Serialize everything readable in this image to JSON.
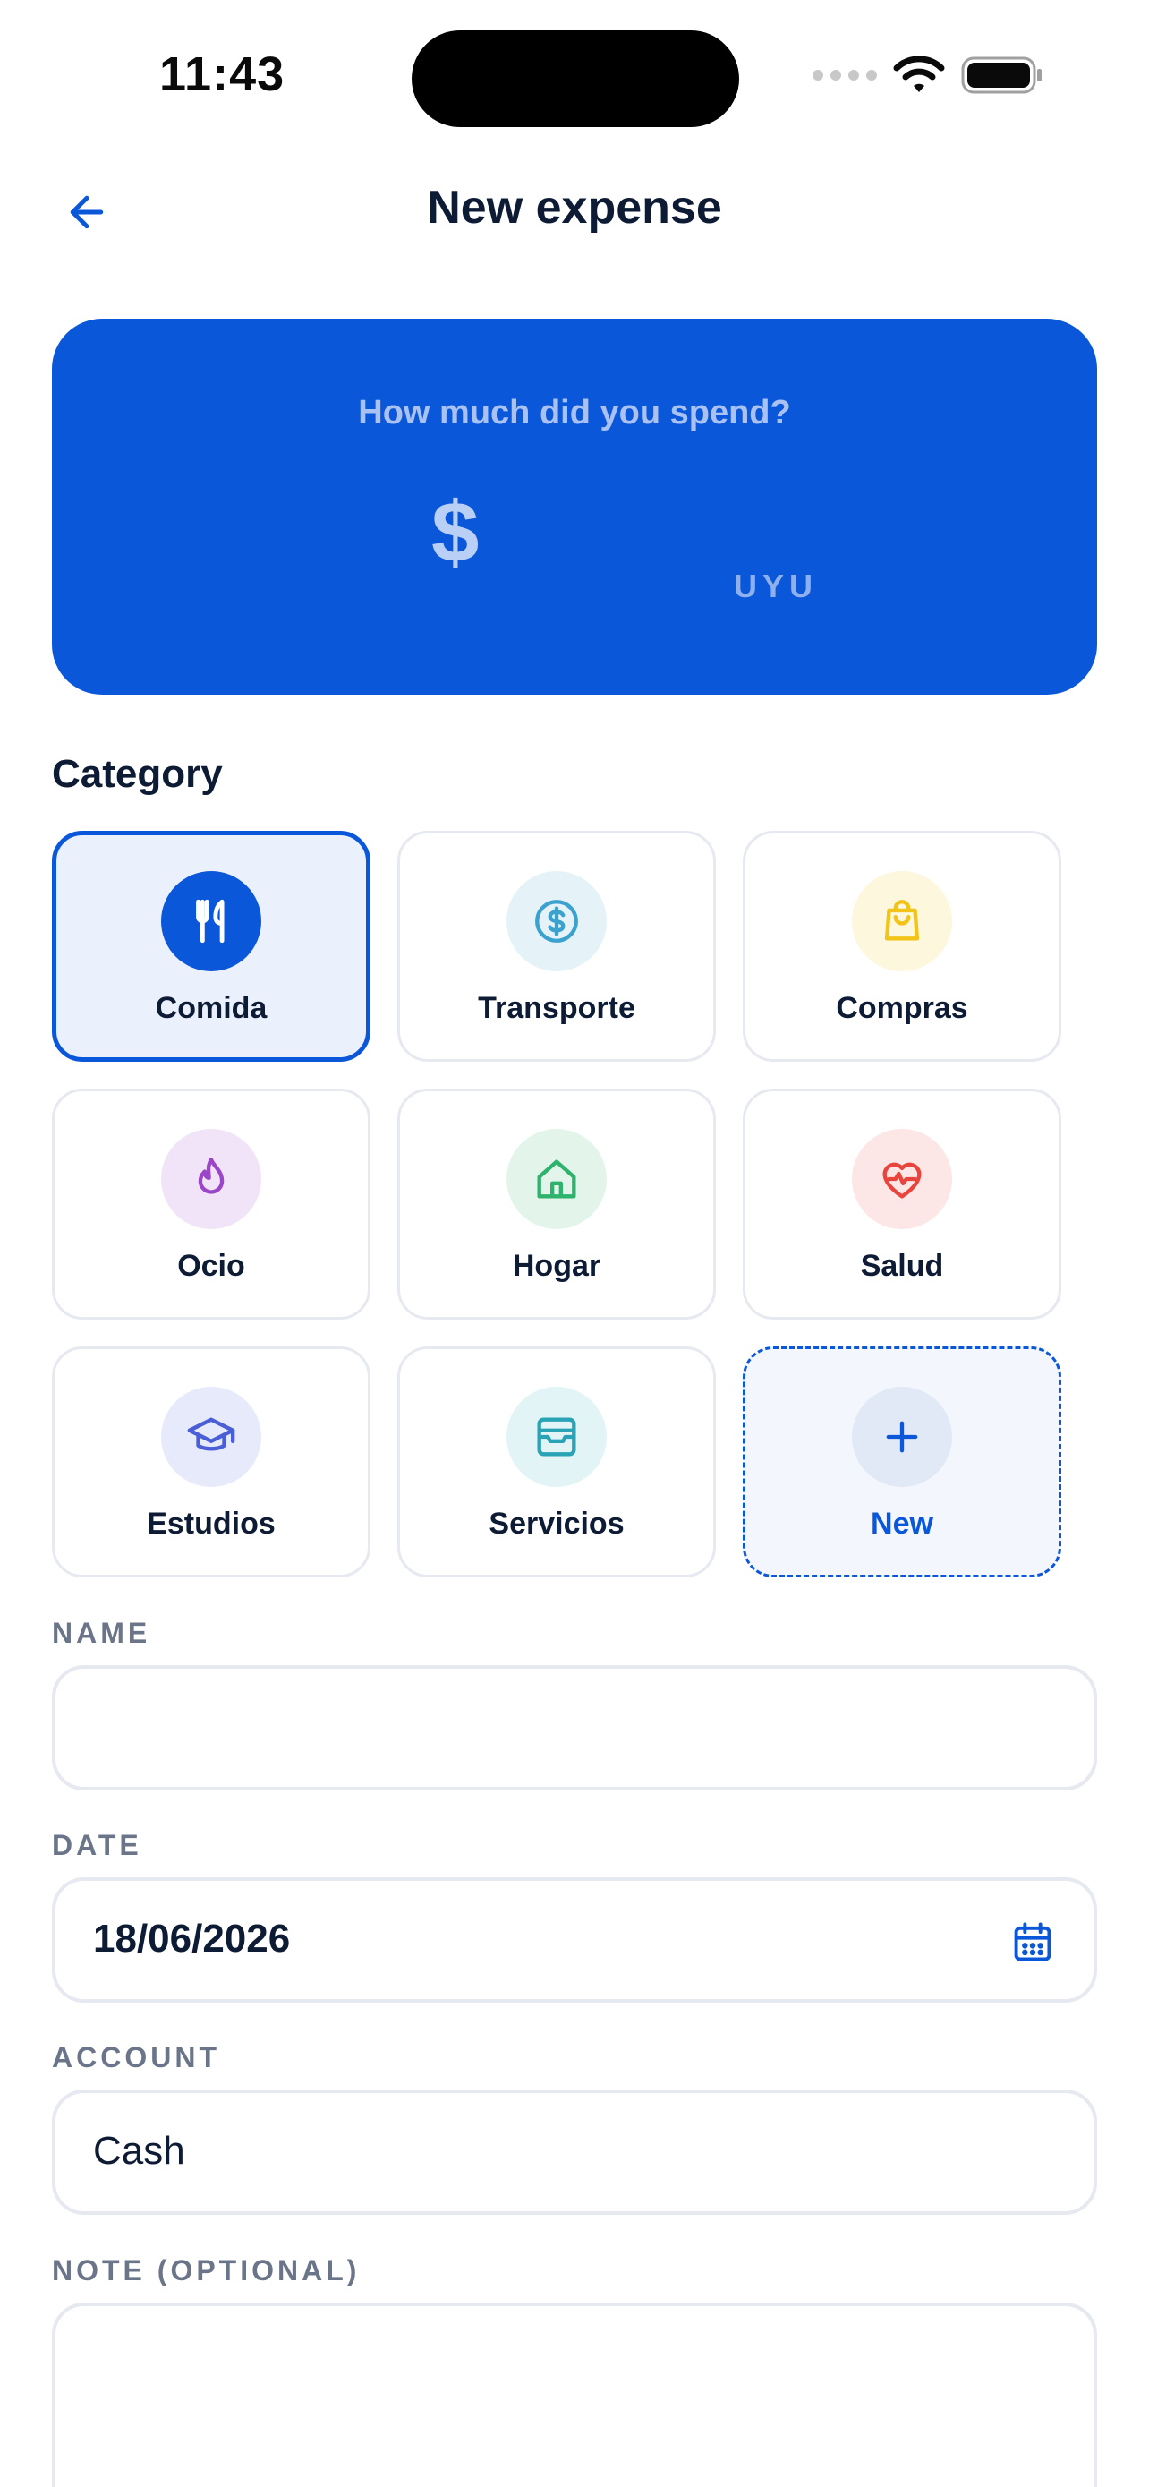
{
  "status_bar": {
    "time": "11:43"
  },
  "header": {
    "title": "New expense"
  },
  "amount_card": {
    "question": "How much did you spend?",
    "currency_symbol": "$",
    "amount_value": "",
    "currency_code": "UYU"
  },
  "category": {
    "heading": "Category",
    "items": [
      {
        "label": "Comida",
        "icon": "utensils-icon",
        "selected": true
      },
      {
        "label": "Transporte",
        "icon": "dollar-circle-icon"
      },
      {
        "label": "Compras",
        "icon": "shopping-bag-icon"
      },
      {
        "label": "Ocio",
        "icon": "flame-icon"
      },
      {
        "label": "Hogar",
        "icon": "home-icon"
      },
      {
        "label": "Salud",
        "icon": "heart-pulse-icon"
      },
      {
        "label": "Estudios",
        "icon": "graduation-cap-icon"
      },
      {
        "label": "Servicios",
        "icon": "wallet-card-icon"
      },
      {
        "label": "New",
        "icon": "plus-icon"
      }
    ]
  },
  "form": {
    "name_label": "NAME",
    "name_value": "",
    "date_label": "DATE",
    "date_value": "18/06/2026",
    "account_label": "ACCOUNT",
    "account_value": "Cash",
    "note_label": "NOTE (OPTIONAL)",
    "note_value": ""
  },
  "colors": {
    "primary": "#0b57d9",
    "text_dark": "#0d1b34",
    "label_gray": "#6b7589",
    "border": "#e6e9f0"
  }
}
